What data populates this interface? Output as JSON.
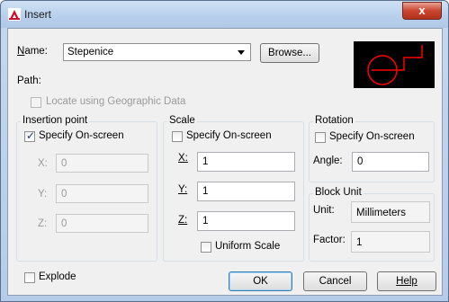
{
  "window": {
    "title": "Insert",
    "close_glyph": "x"
  },
  "name_row": {
    "label": "Name:",
    "value": "Stepenice",
    "browse_label": "Browse..."
  },
  "path": {
    "label": "Path:"
  },
  "geo": {
    "label": "Locate using Geographic Data",
    "checked": false
  },
  "insertion": {
    "title": "Insertion point",
    "specify_label": "Specify On-screen",
    "specify_checked": true,
    "x_label": "X:",
    "x_value": "0",
    "y_label": "Y:",
    "y_value": "0",
    "z_label": "Z:",
    "z_value": "0"
  },
  "scale": {
    "title": "Scale",
    "specify_label": "Specify On-screen",
    "specify_checked": false,
    "x_label": "X:",
    "x_value": "1",
    "y_label": "Y:",
    "y_value": "1",
    "z_label": "Z:",
    "z_value": "1",
    "uniform_label": "Uniform Scale",
    "uniform_checked": false
  },
  "rotation": {
    "title": "Rotation",
    "specify_label": "Specify On-screen",
    "specify_checked": false,
    "angle_label": "Angle:",
    "angle_value": "0"
  },
  "block_unit": {
    "title": "Block Unit",
    "unit_label": "Unit:",
    "unit_value": "Millimeters",
    "factor_label": "Factor:",
    "factor_value": "1"
  },
  "explode": {
    "label": "Explode",
    "checked": false
  },
  "buttons": {
    "ok": "OK",
    "cancel": "Cancel",
    "help": "Help"
  },
  "colors": {
    "preview_bg": "#000000",
    "preview_stroke": "#ff0000",
    "close_red": "#c9452f"
  },
  "icons": {
    "app": "autocad-app-icon",
    "check": "checkmark-icon",
    "dropdown": "dropdown-arrow-icon"
  }
}
